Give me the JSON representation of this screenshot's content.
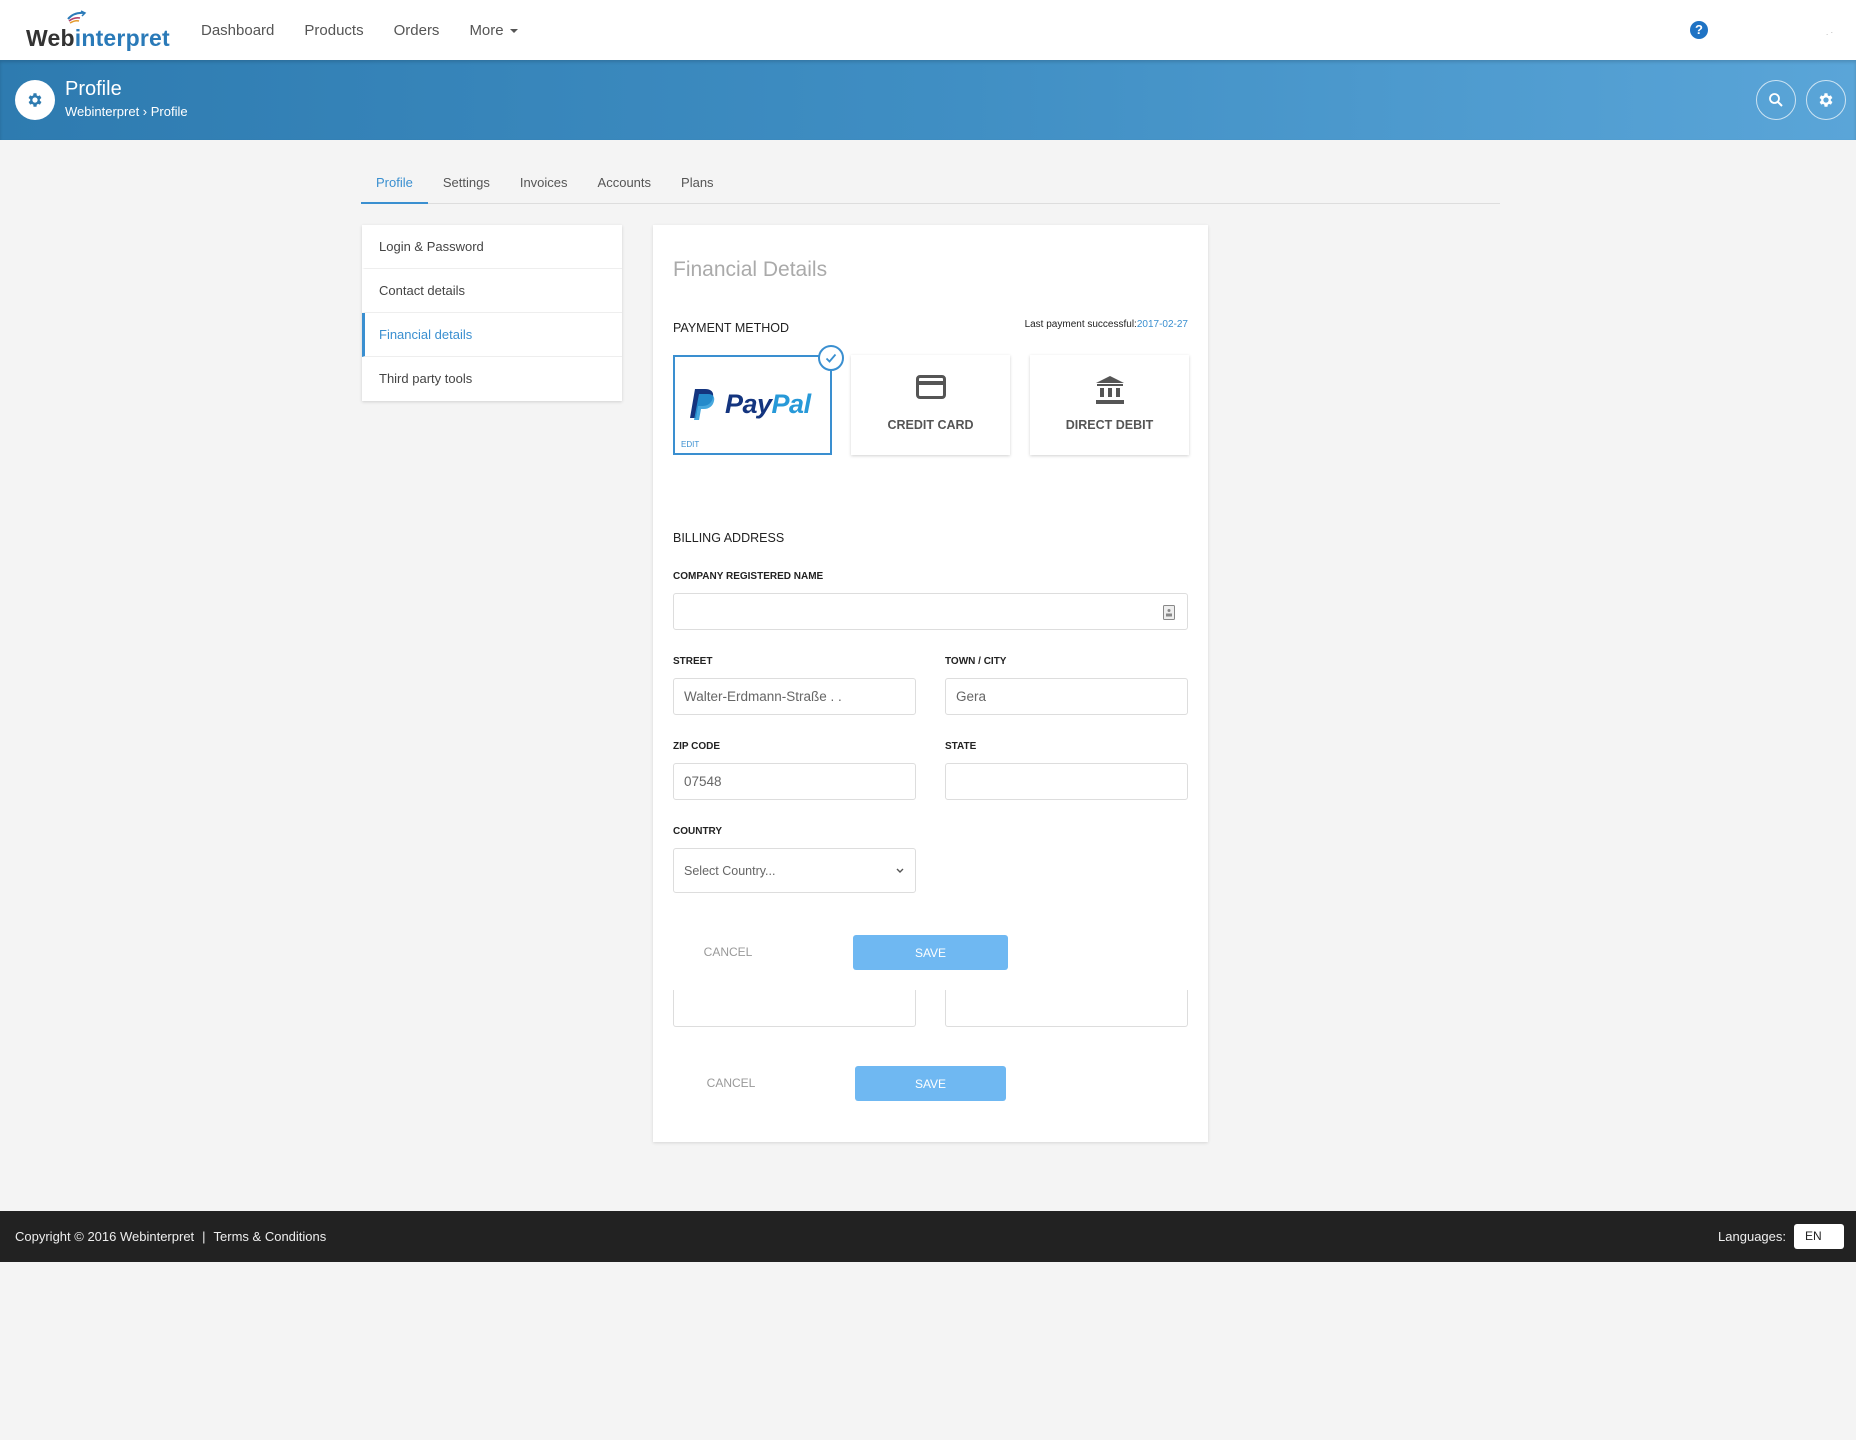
{
  "brand": {
    "name_part1": "Web",
    "name_part2": "interpret"
  },
  "topnav": {
    "links": [
      {
        "label": "Dashboard"
      },
      {
        "label": "Products"
      },
      {
        "label": "Orders"
      },
      {
        "label": "More"
      }
    ],
    "help_icon": "?",
    "user_mark": ". ·"
  },
  "hero": {
    "title": "Profile",
    "breadcrumb": "Webinterpret › Profile",
    "icons": [
      "gear-icon",
      "search-icon",
      "settings-icon"
    ]
  },
  "tabs": [
    {
      "label": "Profile",
      "active": true
    },
    {
      "label": "Settings"
    },
    {
      "label": "Invoices"
    },
    {
      "label": "Accounts"
    },
    {
      "label": "Plans"
    }
  ],
  "sidemenu": [
    {
      "label": "Login & Password"
    },
    {
      "label": "Contact details"
    },
    {
      "label": "Financial details",
      "active": true
    },
    {
      "label": "Third party tools"
    }
  ],
  "card": {
    "title": "Financial Details",
    "payment_method_label": "PAYMENT METHOD",
    "last_payment_label": "Last payment successful:",
    "last_payment_date": "2017-02-27",
    "methods": [
      {
        "name": "PayPal",
        "pay": "Pay",
        "pal": "Pal",
        "edit_label": "EDIT",
        "selected": true
      },
      {
        "name": "CREDIT CARD"
      },
      {
        "name": "DIRECT DEBIT"
      }
    ],
    "billing_label": "BILLING ADDRESS",
    "fields": {
      "company": {
        "label": "COMPANY REGISTERED NAME",
        "value": ""
      },
      "street": {
        "label": "STREET",
        "value": "Walter-Erdmann-Straße  .  ."
      },
      "town": {
        "label": "TOWN / CITY",
        "value": "Gera"
      },
      "zip": {
        "label": "ZIP CODE",
        "value": "07548"
      },
      "state": {
        "label": "STATE",
        "value": ""
      },
      "country": {
        "label": "COUNTRY",
        "placeholder": "Select Country..."
      }
    },
    "buttons": {
      "cancel": "CANCEL",
      "save": "SAVE"
    }
  },
  "footer": {
    "copyright": "Copyright © 2016 Webinterpret",
    "separator": "|",
    "terms": "Terms & Conditions",
    "languages_label": "Languages:",
    "language": "EN"
  },
  "colors": {
    "accent": "#3a8fd0",
    "save_button": "#6fb8f2",
    "footer": "#222222",
    "paypal_dark": "#14357f",
    "paypal_light": "#2799d8"
  }
}
